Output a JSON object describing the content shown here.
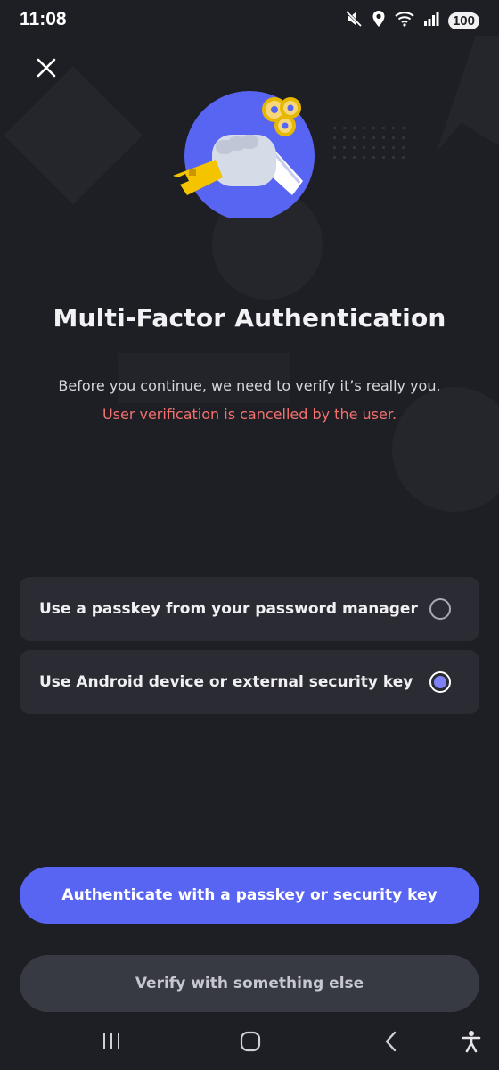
{
  "status_bar": {
    "time": "11:08",
    "battery": "100",
    "icons": [
      "mute-icon",
      "location-icon",
      "wifi-icon",
      "signal-icon"
    ]
  },
  "header": {
    "close_icon": "close-icon",
    "illustration": "hand-holding-key-illustration"
  },
  "main": {
    "title": "Multi-Factor Authentication",
    "subtitle": "Before you continue, we need to verify it’s really you.",
    "error": "User verification is cancelled by the user."
  },
  "options": [
    {
      "label": "Use a passkey from your password manager",
      "selected": false
    },
    {
      "label": "Use Android device or external security key",
      "selected": true
    }
  ],
  "actions": {
    "primary_label": "Authenticate with a passkey or security key",
    "secondary_label": "Verify with something else"
  },
  "nav": {
    "icons": [
      "recents-icon",
      "home-icon",
      "back-icon",
      "accessibility-icon"
    ]
  },
  "colors": {
    "background": "#1e1f24",
    "card": "#2b2c33",
    "accent": "#5865f2",
    "error": "#f2716f",
    "secondary_button": "#383a43"
  }
}
